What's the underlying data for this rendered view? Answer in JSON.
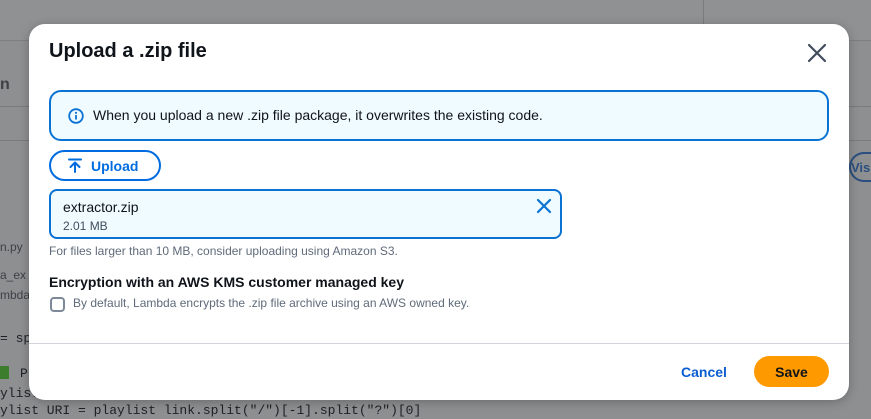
{
  "background": {
    "header_fragment": "n",
    "file_fragment": "n.py",
    "sidebar_fragments": [
      "a_ex",
      "mbda_"
    ],
    "code_fragments": [
      "= sp",
      "P",
      "ylist_",
      "ylist URI = playlist link.split(\"/\")[-1].split(\"?\")[0]"
    ],
    "tab_fragment": "Visu"
  },
  "modal": {
    "title": "Upload a .zip file",
    "close_icon": "close-icon",
    "info": {
      "icon": "info-icon",
      "text": "When you upload a new .zip file package, it overwrites the existing code."
    },
    "upload_button": {
      "icon": "upload-arrow-icon",
      "label": "Upload"
    },
    "file": {
      "name": "extractor.zip",
      "size": "2.01 MB",
      "remove_icon": "close-icon"
    },
    "hint": "For files larger than 10 MB, consider uploading using Amazon S3.",
    "encryption": {
      "title": "Encryption with an AWS KMS customer managed key",
      "checkbox_checked": false,
      "description": "By default, Lambda encrypts the .zip file archive using an AWS owned key."
    },
    "footer": {
      "cancel_label": "Cancel",
      "save_label": "Save"
    }
  },
  "colors": {
    "accent_blue": "#0972d3",
    "link_blue": "#006ce0",
    "info_bg": "#f0fbff",
    "primary_orange": "#ff9900"
  }
}
